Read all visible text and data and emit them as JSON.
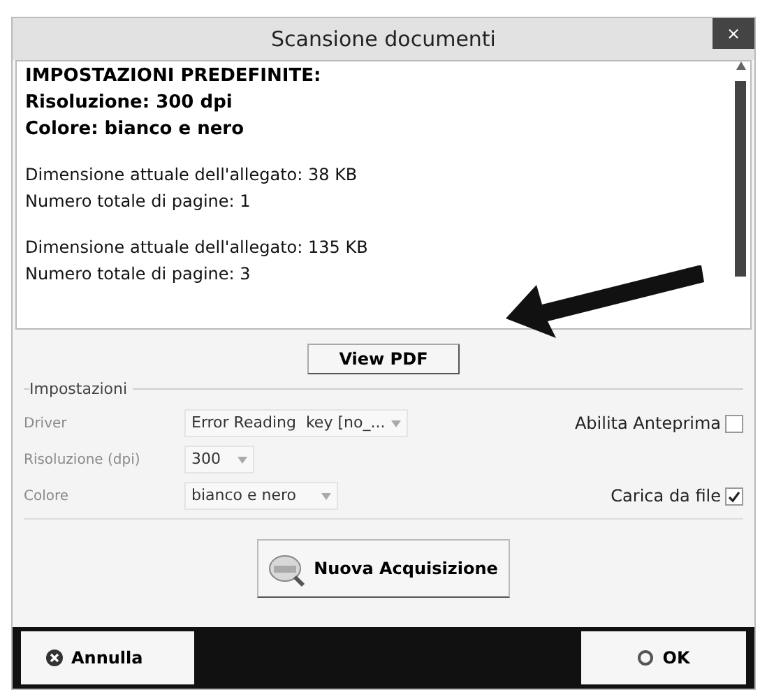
{
  "window": {
    "title": "Scansione documenti",
    "close": "×"
  },
  "report": {
    "paragraphs": [
      {
        "kind": "bold",
        "lines": [
          "IMPOSTAZIONI PREDEFINITE:",
          "Risoluzione: 300 dpi",
          "Colore: bianco e nero"
        ]
      },
      {
        "kind": "normal",
        "lines": [
          "Dimensione attuale dell'allegato: 38 KB",
          "Numero totale di pagine: 1"
        ]
      },
      {
        "kind": "normal",
        "lines": [
          "Dimensione attuale dell'allegato: 135 KB",
          "Numero totale di pagine: 3"
        ]
      }
    ]
  },
  "view_pdf": "View PDF",
  "settings": {
    "title": "Impostazioni",
    "rows": [
      {
        "label": "Driver",
        "value": "Error Reading  key [no_...",
        "option": {
          "label": "Abilita Anteprima",
          "checked": false
        }
      },
      {
        "label": "Risoluzione (dpi)",
        "value": "300"
      },
      {
        "label": "Colore",
        "value": "bianco e nero",
        "option": {
          "label": "Carica da file",
          "checked": true
        }
      }
    ]
  },
  "scan_button": "Nuova Acquisizione",
  "footer": {
    "cancel": "Annulla",
    "ok": "OK"
  }
}
